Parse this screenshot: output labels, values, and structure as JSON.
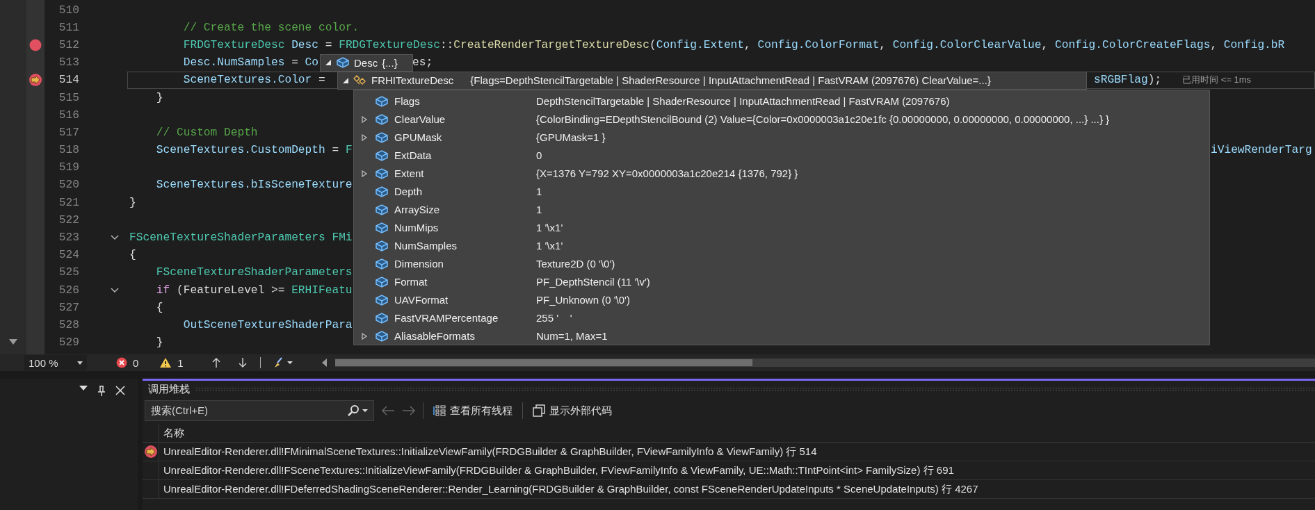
{
  "editor": {
    "lines": [
      {
        "number": "510",
        "breakpoint": false,
        "current": false,
        "foldable": false
      },
      {
        "number": "511",
        "breakpoint": false,
        "current": false,
        "foldable": false,
        "segments": [
          {
            "text": "        // Create the scene color.",
            "kind": "comment"
          }
        ]
      },
      {
        "number": "512",
        "breakpoint": true,
        "current": false,
        "foldable": false,
        "segments": [
          {
            "text": "        FRDGTextureDesc",
            "kind": "type"
          },
          {
            "text": " Desc",
            "kind": "var"
          },
          {
            "text": " = ",
            "kind": "plain"
          },
          {
            "text": "FRDGTextureDesc",
            "kind": "type"
          },
          {
            "text": "::",
            "kind": "plain"
          },
          {
            "text": "CreateRenderTargetTextureDesc",
            "kind": "func"
          },
          {
            "text": "(",
            "kind": "plain"
          },
          {
            "text": "Config.Extent",
            "kind": "var"
          },
          {
            "text": ", ",
            "kind": "plain"
          },
          {
            "text": "Config.ColorFormat",
            "kind": "var"
          },
          {
            "text": ", ",
            "kind": "plain"
          },
          {
            "text": "Config.ColorClearValue",
            "kind": "var"
          },
          {
            "text": ", ",
            "kind": "plain"
          },
          {
            "text": "Config.ColorCreateFlags",
            "kind": "var"
          },
          {
            "text": ", ",
            "kind": "plain"
          },
          {
            "text": "Config.bR",
            "kind": "var"
          }
        ]
      },
      {
        "number": "513",
        "breakpoint": false,
        "current": false,
        "foldable": false,
        "segments": [
          {
            "text": "        Desc.NumSamples",
            "kind": "var"
          },
          {
            "text": " = ",
            "kind": "plain"
          },
          {
            "text": "Co",
            "kind": "var"
          }
        ],
        "tail": [
          {
            "text": "es;",
            "kind": "plain"
          }
        ]
      },
      {
        "number": "514",
        "breakpoint": false,
        "current": true,
        "foldable": false,
        "segments": [
          {
            "text": "        SceneTextures.Color",
            "kind": "var"
          },
          {
            "text": " = ",
            "kind": "plain"
          }
        ],
        "tail": [
          {
            "text": "sRGBFlag",
            "kind": "var"
          },
          {
            "text": ");",
            "kind": "plain"
          }
        ],
        "hint": "已用时间 <= 1ms"
      },
      {
        "number": "515",
        "breakpoint": false,
        "current": false,
        "foldable": false,
        "segments": [
          {
            "text": "    }",
            "kind": "plain"
          }
        ]
      },
      {
        "number": "516",
        "breakpoint": false,
        "current": false,
        "foldable": false
      },
      {
        "number": "517",
        "breakpoint": false,
        "current": false,
        "foldable": false,
        "segments": [
          {
            "text": "    // Custom Depth",
            "kind": "comment"
          }
        ]
      },
      {
        "number": "518",
        "breakpoint": false,
        "current": false,
        "foldable": false,
        "segments": [
          {
            "text": "    SceneTextures.CustomDepth",
            "kind": "var"
          },
          {
            "text": " = ",
            "kind": "plain"
          },
          {
            "text": "F",
            "kind": "type"
          }
        ],
        "tail": [
          {
            "text": "iViewRenderTarg",
            "kind": "var"
          }
        ]
      },
      {
        "number": "519",
        "breakpoint": false,
        "current": false,
        "foldable": false
      },
      {
        "number": "520",
        "breakpoint": false,
        "current": false,
        "foldable": false,
        "segments": [
          {
            "text": "    SceneTextures.bIsSceneTexture",
            "kind": "var"
          }
        ]
      },
      {
        "number": "521",
        "breakpoint": false,
        "current": false,
        "foldable": false,
        "segments": [
          {
            "text": "}",
            "kind": "plain"
          }
        ]
      },
      {
        "number": "522",
        "breakpoint": false,
        "current": false,
        "foldable": false
      },
      {
        "number": "523",
        "breakpoint": false,
        "current": false,
        "foldable": true,
        "segments": [
          {
            "text": "FSceneTextureShaderParameters",
            "kind": "type"
          },
          {
            "text": " FMi",
            "kind": "type"
          }
        ]
      },
      {
        "number": "524",
        "breakpoint": false,
        "current": false,
        "foldable": false,
        "segments": [
          {
            "text": "{",
            "kind": "plain"
          }
        ]
      },
      {
        "number": "525",
        "breakpoint": false,
        "current": false,
        "foldable": false,
        "segments": [
          {
            "text": "    FSceneTextureShaderParameters",
            "kind": "type"
          }
        ]
      },
      {
        "number": "526",
        "breakpoint": false,
        "current": false,
        "foldable": true,
        "segments": [
          {
            "text": "    if",
            "kind": "keyword"
          },
          {
            "text": " (FeatureLevel >= ",
            "kind": "plain"
          },
          {
            "text": "ERHIFeatu",
            "kind": "type"
          }
        ]
      },
      {
        "number": "527",
        "breakpoint": false,
        "current": false,
        "foldable": false,
        "segments": [
          {
            "text": "    {",
            "kind": "plain"
          }
        ]
      },
      {
        "number": "528",
        "breakpoint": false,
        "current": false,
        "foldable": false,
        "segments": [
          {
            "text": "        OutSceneTextureShaderPara",
            "kind": "var"
          }
        ]
      },
      {
        "number": "529",
        "breakpoint": false,
        "current": false,
        "foldable": false,
        "segments": [
          {
            "text": "    }",
            "kind": "plain"
          }
        ]
      }
    ]
  },
  "datatip": {
    "variable": {
      "name": "Desc",
      "value": "{...}",
      "expanded": true
    },
    "type_row": {
      "type": "FRHITextureDesc",
      "value": "{Flags=DepthStencilTargetable | ShaderResource | InputAttachmentRead | FastVRAM (2097676) ClearValue=...}",
      "expanded": true
    },
    "members": [
      {
        "name": "Flags",
        "value": "DepthStencilTargetable | ShaderResource | InputAttachmentRead | FastVRAM (2097676)",
        "expandable": false
      },
      {
        "name": "ClearValue",
        "value": "{ColorBinding=EDepthStencilBound (2) Value={Color=0x0000003a1c20e1fc {0.00000000, 0.00000000, 0.00000000, ...} ...} }",
        "expandable": true
      },
      {
        "name": "GPUMask",
        "value": "{GPUMask=1 }",
        "expandable": true
      },
      {
        "name": "ExtData",
        "value": "0",
        "expandable": false
      },
      {
        "name": "Extent",
        "value": "{X=1376 Y=792 XY=0x0000003a1c20e214 {1376, 792} }",
        "expandable": true
      },
      {
        "name": "Depth",
        "value": "1",
        "expandable": false
      },
      {
        "name": "ArraySize",
        "value": "1",
        "expandable": false
      },
      {
        "name": "NumMips",
        "value": "1 '\\x1'",
        "expandable": false
      },
      {
        "name": "NumSamples",
        "value": "1 '\\x1'",
        "expandable": false
      },
      {
        "name": "Dimension",
        "value": "Texture2D (0 '\\0')",
        "expandable": false
      },
      {
        "name": "Format",
        "value": "PF_DepthStencil (11 '\\v')",
        "expandable": false
      },
      {
        "name": "UAVFormat",
        "value": "PF_Unknown (0 '\\0')",
        "expandable": false
      },
      {
        "name": "FastVRAMPercentage",
        "value": "255 '    '",
        "expandable": false
      },
      {
        "name": "AliasableFormats",
        "value": "Num=1, Max=1",
        "expandable": true
      }
    ]
  },
  "status_bar": {
    "zoom": "100 %",
    "errors": "0",
    "warnings": "1"
  },
  "call_stack": {
    "title": "调用堆栈",
    "search": {
      "placeholder": "搜索(Ctrl+E)"
    },
    "buttons": [
      {
        "label": "查看所有线程",
        "kind": "threads"
      },
      {
        "label": "显示外部代码",
        "kind": "external"
      }
    ],
    "column": "名称",
    "rows": [
      {
        "text": "UnrealEditor-Renderer.dll!FMinimalSceneTextures::InitializeViewFamily(FRDGBuilder & GraphBuilder, FViewFamilyInfo & ViewFamily) 行 514",
        "current": true
      },
      {
        "text": "UnrealEditor-Renderer.dll!FSceneTextures::InitializeViewFamily(FRDGBuilder & GraphBuilder, FViewFamilyInfo & ViewFamily, UE::Math::TIntPoint<int> FamilySize) 行 691",
        "current": false
      },
      {
        "text": "UnrealEditor-Renderer.dll!FDeferredShadingSceneRenderer::Render_Learning(FRDGBuilder & GraphBuilder, const FSceneRenderUpdateInputs * SceneUpdateInputs) 行 4267",
        "current": false
      }
    ]
  }
}
